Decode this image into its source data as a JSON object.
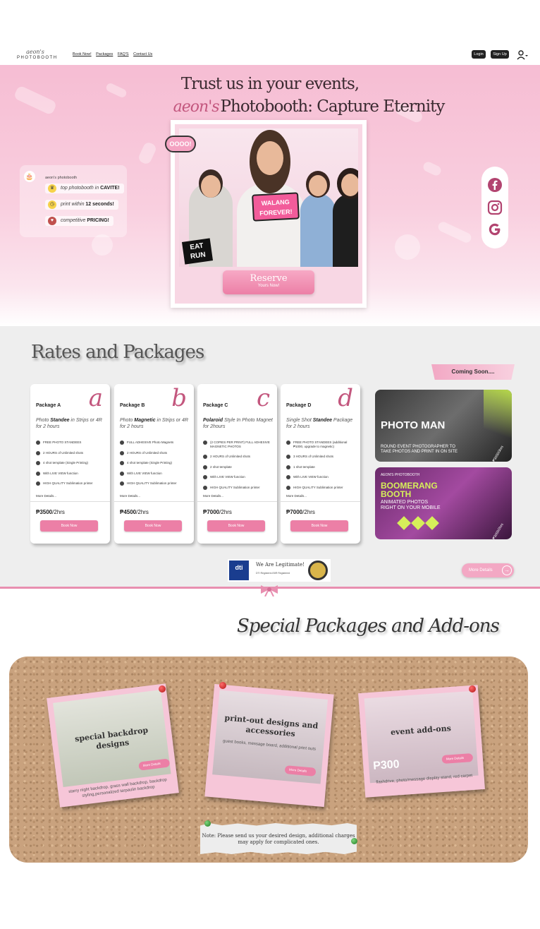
{
  "nav": {
    "logo_script": "aeon's",
    "logo_brand": "PHOTOBOOTH",
    "links": [
      "Book Now!",
      "Packages",
      "FAQ'S",
      "Contact Us"
    ],
    "login": "Login",
    "signup": "Sign Up"
  },
  "hero": {
    "line1": "Trust us  in your events,",
    "script": "aeon's",
    "line2": "Photobooth: Capture Eternity",
    "sign_text": "WALANG FOREVER!",
    "eat_text": "EAT RUN",
    "bubble_text": "OOOO!",
    "reserve": "Reserve",
    "reserve_sub": "Yours Now!",
    "features_title": "aeon's photobooth",
    "features": [
      {
        "pre": "top photobooth in ",
        "bold": "CAVITE!",
        "post": ""
      },
      {
        "pre": "print within ",
        "bold": "12 seconds!",
        "post": ""
      },
      {
        "pre": "competitive ",
        "bold": "PRICING!",
        "post": ""
      }
    ],
    "social": [
      "facebook-icon",
      "instagram-icon",
      "google-icon"
    ]
  },
  "rates": {
    "title": "Rates and Packages",
    "coming_soon": "Coming Soon....",
    "packages": [
      {
        "name": "Package A",
        "letter": "a",
        "desc_pre": "Photo ",
        "desc_bold": "Standee",
        "desc_post": " in Strips or 4R for 2 hours",
        "features": [
          "FREE PHOTO STANDEES",
          "2 HOURS of Unlimited shots",
          "4 shot template (Single Printing)",
          "With LIVE VIEW function",
          "HIGH QUALITY Sublimation printer"
        ],
        "more": "More Details...",
        "price": "₱3500",
        "unit": "/2hrs",
        "book": "Book Now"
      },
      {
        "name": "Package B",
        "letter": "b",
        "desc_pre": "Photo ",
        "desc_bold": "Magnetic",
        "desc_post": " in Strips or 4R for 2 hours",
        "features": [
          "FULL ADHESIVE Photo Magnets",
          "2 HOURS of Unlimited shots",
          "4 shot template (Single Printing)",
          "With LIVE VIEW function",
          "HIGH QUALITY Sublimation printer"
        ],
        "more": "More Details...",
        "price": "₱4500",
        "unit": "/2hrs",
        "book": "Book Now"
      },
      {
        "name": "Package C",
        "letter": "c",
        "desc_pre": "",
        "desc_bold": "Polaroid",
        "desc_post": " Style In Photo Magnet for 2hours",
        "features": [
          "(2 COPIES PER PRINT) FULL ADHESIVE MAGNETIC PHOTOS",
          "2 HOURS of Unlimited shots",
          "2 shot template",
          "With LIVE VIEW function",
          "HIGH QUALITY Sublimation printer"
        ],
        "more": "More Details...",
        "price": "₱7000",
        "unit": "/2hrs",
        "book": "Book Now"
      },
      {
        "name": "Package D",
        "letter": "d",
        "desc_pre": "Single Shot ",
        "desc_bold": "Standee",
        "desc_post": " Package for 2 hours",
        "features": [
          "FREE PHOTO STANDEES (additional ₱1000, upgrade to magnetic)",
          "3 HOURS of Unlimited shots",
          "1 shot template",
          "With LIVE VIEW function",
          "HIGH QUALITY Sublimation printer"
        ],
        "more": "More Details...",
        "price": "₱7000",
        "unit": "/2hrs",
        "book": "Book Now"
      }
    ],
    "coming": [
      {
        "title": "PHOTO MAN",
        "sub": "ROUND EVENT PHOTOGRAPHER TO TAKE PHOTOS AND PRINT IN ON SITE",
        "price": "₱3000/3hrs"
      },
      {
        "kicker": "AEON'S PHOTOBOOTH",
        "title": "BOOMERANG BOOTH",
        "sub": "ANIMATED PHOTOS RIGHT ON YOUR MOBILE",
        "price": "₱3000/2hrs"
      }
    ],
    "legit_title": "We Are Legitimate!",
    "legit_sub": "DTI Registered     BIR Registered",
    "dti": "dti",
    "more_details": "More Details"
  },
  "special": {
    "title": "Special Packages and Add-ons",
    "items": [
      {
        "title": "special backdrop designs",
        "sub": "starry night backdrop, grass wall backdrop, backdrop styling,personalized tarpaulin backdrop",
        "btn": "More Details"
      },
      {
        "title": "print-out designs and accessories",
        "sub": "guest books, message board, additional print outs",
        "btn": "More Details"
      },
      {
        "title": "event add-ons",
        "sub": "flashdrive, photo/message display stand, red carpet",
        "btn": "More Details",
        "price_tag": "P300"
      }
    ],
    "note": "Note: Please send us your desired design, additional charges may apply for complicated ones."
  },
  "colors": {
    "accent": "#ec7fa6",
    "hero_bg": "#f6bdd3",
    "rose": "#c3577e"
  }
}
